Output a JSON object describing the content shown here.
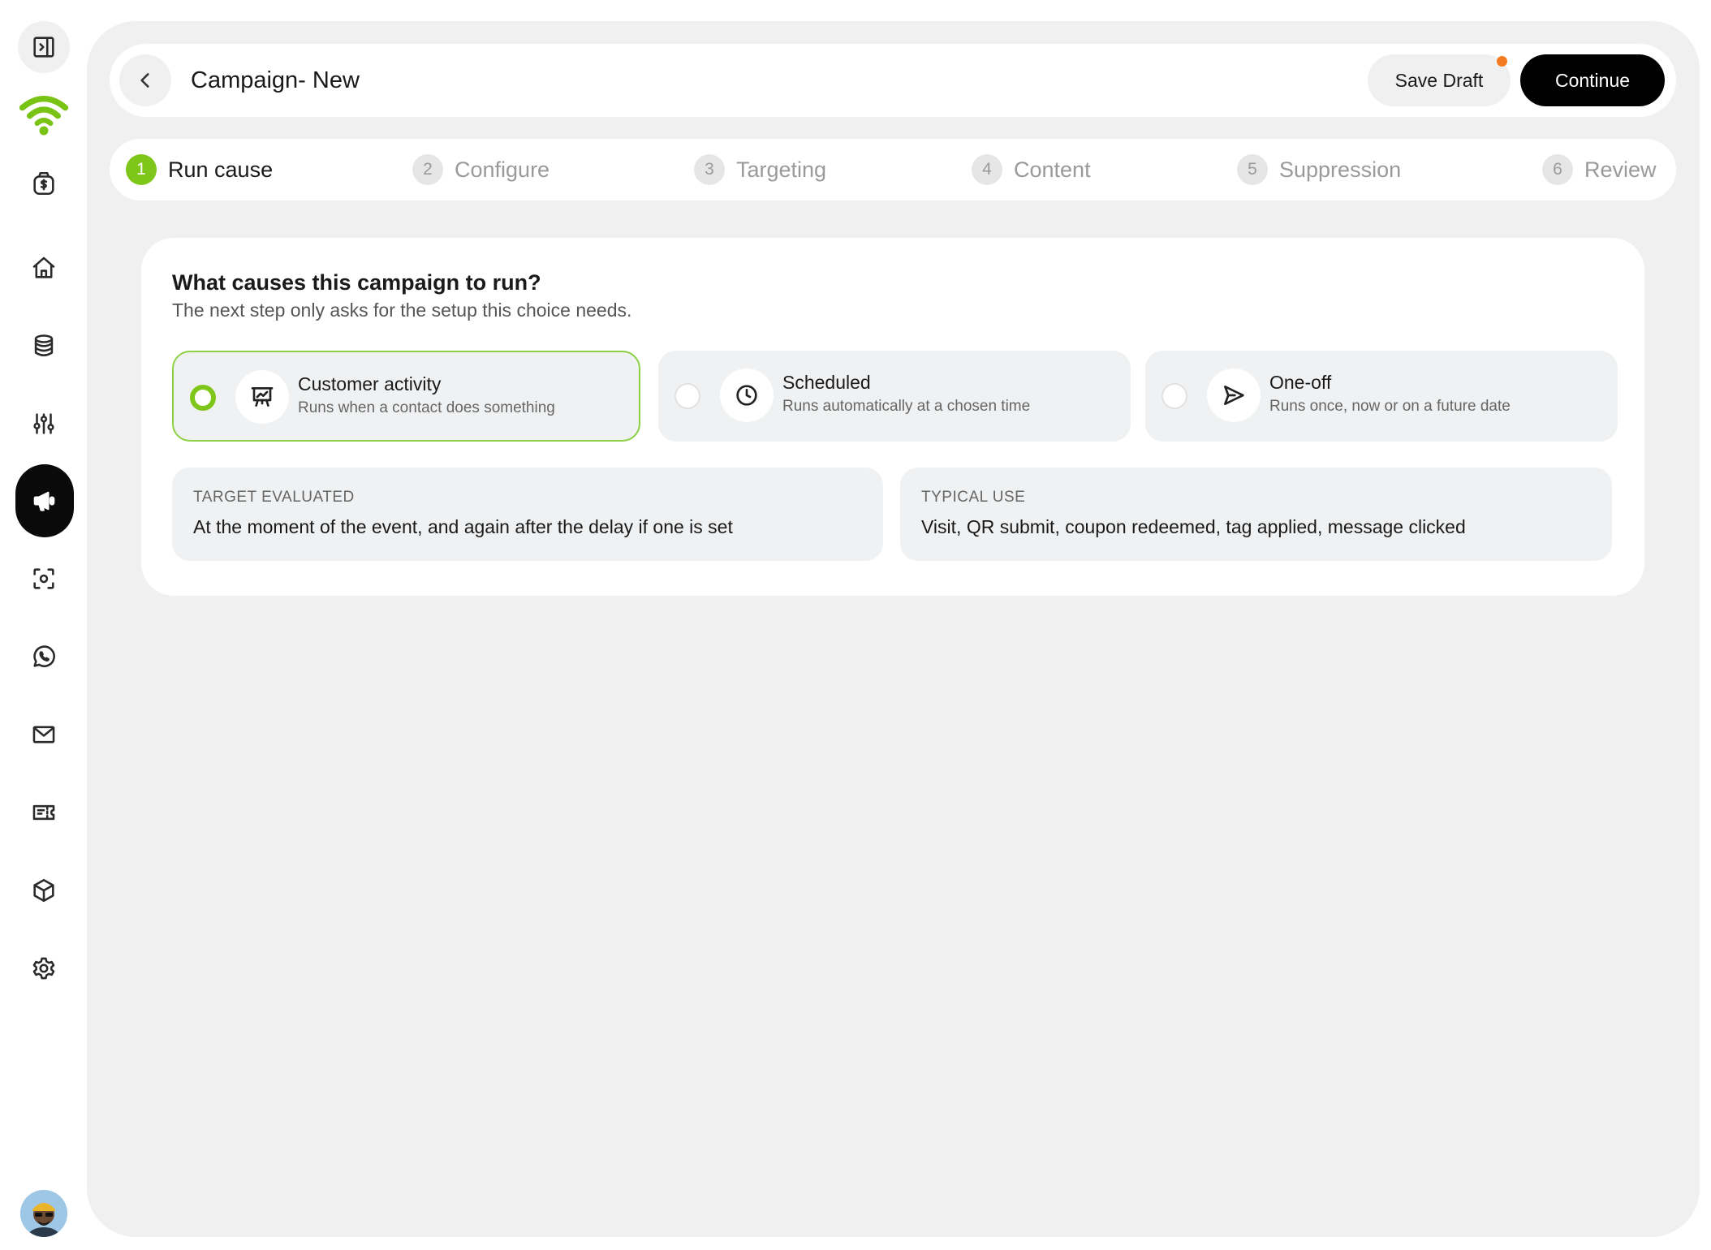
{
  "sidebar": {
    "items": [
      {
        "icon": "panel-toggle-icon"
      },
      {
        "icon": "wifi-logo-icon"
      },
      {
        "icon": "money-bag-icon"
      },
      {
        "icon": "home-icon"
      },
      {
        "icon": "database-icon"
      },
      {
        "icon": "sliders-icon"
      },
      {
        "icon": "megaphone-icon",
        "active": true
      },
      {
        "icon": "scan-icon"
      },
      {
        "icon": "whatsapp-icon"
      },
      {
        "icon": "mail-icon"
      },
      {
        "icon": "ticket-icon"
      },
      {
        "icon": "box-icon"
      },
      {
        "icon": "settings-icon"
      }
    ],
    "avatar_icon": "user-avatar"
  },
  "header": {
    "title": "Campaign- New",
    "save_draft_label": "Save Draft",
    "continue_label": "Continue"
  },
  "stepper": {
    "steps": [
      {
        "num": "1",
        "label": "Run cause",
        "active": true
      },
      {
        "num": "2",
        "label": "Configure"
      },
      {
        "num": "3",
        "label": "Targeting"
      },
      {
        "num": "4",
        "label": "Content"
      },
      {
        "num": "5",
        "label": "Suppression"
      },
      {
        "num": "6",
        "label": "Review"
      }
    ]
  },
  "card": {
    "question": "What causes this campaign to run?",
    "subtitle": "The next step only asks for the setup this choice needs.",
    "options": [
      {
        "title": "Customer activity",
        "desc": "Runs when a contact does something",
        "icon": "presentation-chart-icon",
        "selected": true
      },
      {
        "title": "Scheduled",
        "desc": "Runs automatically at a chosen time",
        "icon": "clock-icon",
        "selected": false
      },
      {
        "title": "One-off",
        "desc": "Runs once, now or on a future date",
        "icon": "send-icon",
        "selected": false
      }
    ],
    "info": [
      {
        "label": "TARGET EVALUATED",
        "value": "At the moment of the event, and again after the delay if one is set"
      },
      {
        "label": "TYPICAL USE",
        "value": "Visit, QR submit, coupon redeemed, tag applied, message clicked"
      }
    ]
  },
  "colors": {
    "accent_green": "#7ec61a",
    "draft_dot": "#f47a20",
    "primary_button": "#000000"
  }
}
